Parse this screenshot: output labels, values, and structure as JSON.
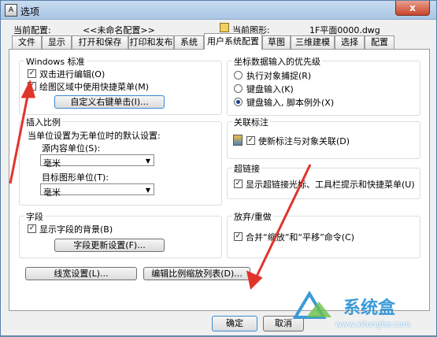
{
  "window": {
    "title": "选项",
    "close_glyph": "x"
  },
  "header": {
    "current_profile_label": "当前配置:",
    "current_profile_value": "<<未命名配置>>",
    "current_drawing_label": "当前图形:",
    "current_drawing_value": "1F平面0000.dwg"
  },
  "tabs": [
    {
      "label": "文件"
    },
    {
      "label": "显示"
    },
    {
      "label": "打开和保存"
    },
    {
      "label": "打印和发布"
    },
    {
      "label": "系统"
    },
    {
      "label": "用户系统配置"
    },
    {
      "label": "草图"
    },
    {
      "label": "三维建模"
    },
    {
      "label": "选择"
    },
    {
      "label": "配置"
    }
  ],
  "active_tab": "用户系统配置",
  "windows_std": {
    "title": "Windows 标准",
    "dblclick_edit": "双击进行编辑(O)",
    "shortcut_menu": "绘图区域中使用快捷菜单(M)",
    "custom_right_click": "自定义右键单击(I)..."
  },
  "insert_scale": {
    "title": "插入比例",
    "desc": "当单位设置为无单位时的默认设置:",
    "source_units_label": "源内容单位(S):",
    "source_units_value": "毫米",
    "target_units_label": "目标图形单位(T):",
    "target_units_value": "毫米"
  },
  "fields": {
    "title": "字段",
    "show_bg": "显示字段的背景(B)",
    "update_settings": "字段更新设置(F)..."
  },
  "coord_priority": {
    "title": "坐标数据输入的优先级",
    "opt1": "执行对象捕捉(R)",
    "opt2": "键盘输入(K)",
    "opt3": "键盘输入, 脚本例外(X)"
  },
  "assoc_dim": {
    "title": "关联标注",
    "label": "使新标注与对象关联(D)"
  },
  "hyperlink": {
    "title": "超链接",
    "label": "显示超链接光标、工具栏提示和快捷菜单(U)"
  },
  "undo": {
    "title": "放弃/重做",
    "label": "合并“缩放”和“平移”命令(C)"
  },
  "bottom_buttons": {
    "lineweight": "线宽设置(L)...",
    "scale_list": "编辑比例缩放列表(D)..."
  },
  "dialog_buttons": {
    "ok": "确定",
    "cancel": "取消"
  },
  "watermark": {
    "brand": "系统盒",
    "url": "www.xitonghe.com"
  },
  "colors": {
    "arrow": "#e0342b",
    "focus_border": "#3a8ad6"
  }
}
